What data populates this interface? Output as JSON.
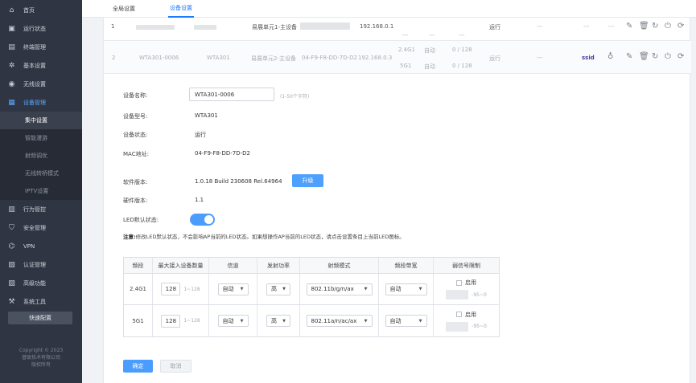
{
  "sidebar": {
    "items": [
      {
        "label": "首页",
        "icon": "home-icon",
        "glyph": "⌂"
      },
      {
        "label": "运行状态",
        "icon": "monitor-icon",
        "glyph": "▣"
      },
      {
        "label": "终端管理",
        "icon": "device-icon",
        "glyph": "▤"
      },
      {
        "label": "基本设置",
        "icon": "gear-icon",
        "glyph": "✲"
      },
      {
        "label": "无线设置",
        "icon": "wireless-icon",
        "glyph": "◉"
      },
      {
        "label": "设备管理",
        "icon": "grid-icon",
        "glyph": "▦"
      }
    ],
    "sub_items": [
      "集中设置",
      "智能漫游",
      "射频调优",
      "无线转桥模式",
      "IPTV设置"
    ],
    "items2": [
      {
        "label": "行为管控",
        "icon": "behavior-icon",
        "glyph": "▥"
      },
      {
        "label": "安全管理",
        "icon": "shield-icon",
        "glyph": "⛉"
      },
      {
        "label": "VPN",
        "icon": "vpn-icon",
        "glyph": "⌬"
      },
      {
        "label": "认证管理",
        "icon": "auth-icon",
        "glyph": "▧"
      },
      {
        "label": "高级功能",
        "icon": "advanced-icon",
        "glyph": "▨"
      },
      {
        "label": "系统工具",
        "icon": "tools-icon",
        "glyph": "⚒"
      }
    ],
    "quick_config": "快速配置",
    "copyright": [
      "Copyright © 2023",
      "普联技术有限公司",
      "版权所有"
    ]
  },
  "tabs": [
    "全局设置",
    "设备设置"
  ],
  "rows": [
    {
      "index": "1",
      "desc": "易展单元1-主设备",
      "ip": "192.168.0.1",
      "status": "运行",
      "dash1": "---",
      "dash2": "---"
    },
    {
      "index": "2",
      "model_id": "WTA301-0006",
      "model": "WTA301",
      "desc": "易展单元2-主设备",
      "mac": "04-F9-F8-DD-7D-D2",
      "ip": "192.168.0.3",
      "band1": "2.4G1",
      "band2": "5G1",
      "ch1": "自动",
      "ch2": "自动",
      "cnt1": "0 / 128",
      "cnt2": "0 / 128",
      "status": "运行",
      "dash": "---",
      "ssid": "ssid"
    }
  ],
  "form": {
    "name_label": "设备名称:",
    "name_value": "WTA301-0006",
    "name_hint": "(1-50个字符)",
    "model_label": "设备型号:",
    "model_value": "WTA301",
    "status_label": "设备状态:",
    "status_value": "运行",
    "mac_label": "MAC地址:",
    "mac_value": "04-F9-F8-DD-7D-D2",
    "sw_label": "软件版本:",
    "sw_value": "1.0.18 Build 230608 Rel.64964",
    "upgrade": "升级",
    "hw_label": "硬件版本:",
    "hw_value": "1.1",
    "led_label": "LED默认状态:",
    "note_bold": "注意:",
    "note_text": "修改LED默认状态，不会影响AP当前的LED状态。如果想操作AP当前的LED状态，请点击设置条目上当前LED图标。"
  },
  "radio_table": {
    "headers": [
      "频段",
      "最大接入设备数量",
      "信道",
      "发射功率",
      "射频模式",
      "频段带宽",
      "弱信号限制"
    ],
    "rows": [
      {
        "band": "2.4G1",
        "max": "128",
        "range": "1~128",
        "channel": "自动",
        "power": "高",
        "mode": "802.11b/g/n/ax",
        "width": "自动",
        "enable": "启用",
        "weak_range": "-95~0"
      },
      {
        "band": "5G1",
        "max": "128",
        "range": "1~128",
        "channel": "自动",
        "power": "高",
        "mode": "802.11a/n/ac/ax",
        "width": "自动",
        "enable": "启用",
        "weak_range": "-95~0"
      }
    ]
  },
  "buttons": {
    "ok": "确定",
    "cancel": "取消"
  },
  "colors": {
    "accent": "#1a7cff",
    "sidebar": "#2f3542",
    "button": "#4a9dff"
  }
}
